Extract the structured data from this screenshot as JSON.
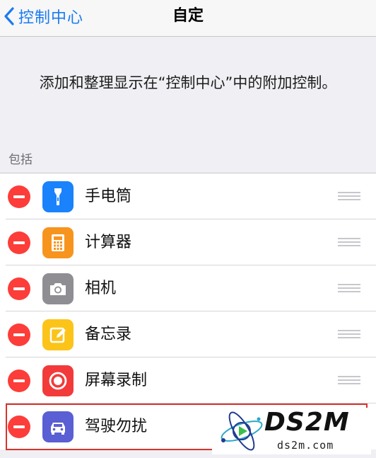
{
  "navbar": {
    "back_label": "控制中心",
    "title": "自定"
  },
  "description": "添加和整理显示在“控制中心”中的附加控制。",
  "section_header": "包括",
  "items": [
    {
      "label": "手电筒",
      "icon": "flashlight-icon",
      "icon_bg": "#1a82fb"
    },
    {
      "label": "计算器",
      "icon": "calculator-icon",
      "icon_bg": "#f7941d"
    },
    {
      "label": "相机",
      "icon": "camera-icon",
      "icon_bg": "#8e8e93"
    },
    {
      "label": "备忘录",
      "icon": "notes-icon",
      "icon_bg": "#fcc419"
    },
    {
      "label": "屏幕录制",
      "icon": "screen-recording-icon",
      "icon_bg": "#f23a3a"
    },
    {
      "label": "驾驶勿扰",
      "icon": "car-icon",
      "icon_bg": "#5a5fd3"
    }
  ],
  "watermark": {
    "title": "DS2M",
    "subtitle": "ds2m.com"
  },
  "colors": {
    "accent": "#1a7bf2",
    "delete": "#fc3d39",
    "highlight_border": "#d9342b"
  }
}
